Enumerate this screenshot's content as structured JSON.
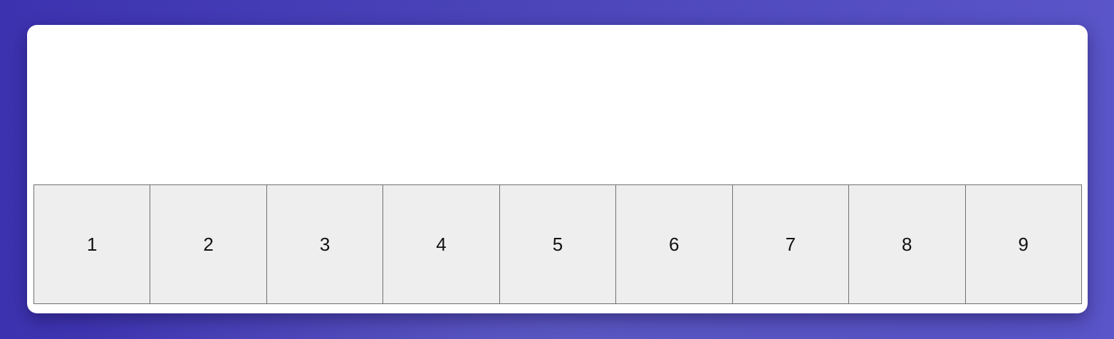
{
  "colors": {
    "backdrop": "#4a44b8",
    "panel": "#ffffff",
    "tile_fill": "#eeeeee",
    "tile_border": "#6f6f6f",
    "tile_text": "#111111"
  },
  "tiles": [
    {
      "label": "1"
    },
    {
      "label": "2"
    },
    {
      "label": "3"
    },
    {
      "label": "4"
    },
    {
      "label": "5"
    },
    {
      "label": "6"
    },
    {
      "label": "7"
    },
    {
      "label": "8"
    },
    {
      "label": "9"
    }
  ]
}
